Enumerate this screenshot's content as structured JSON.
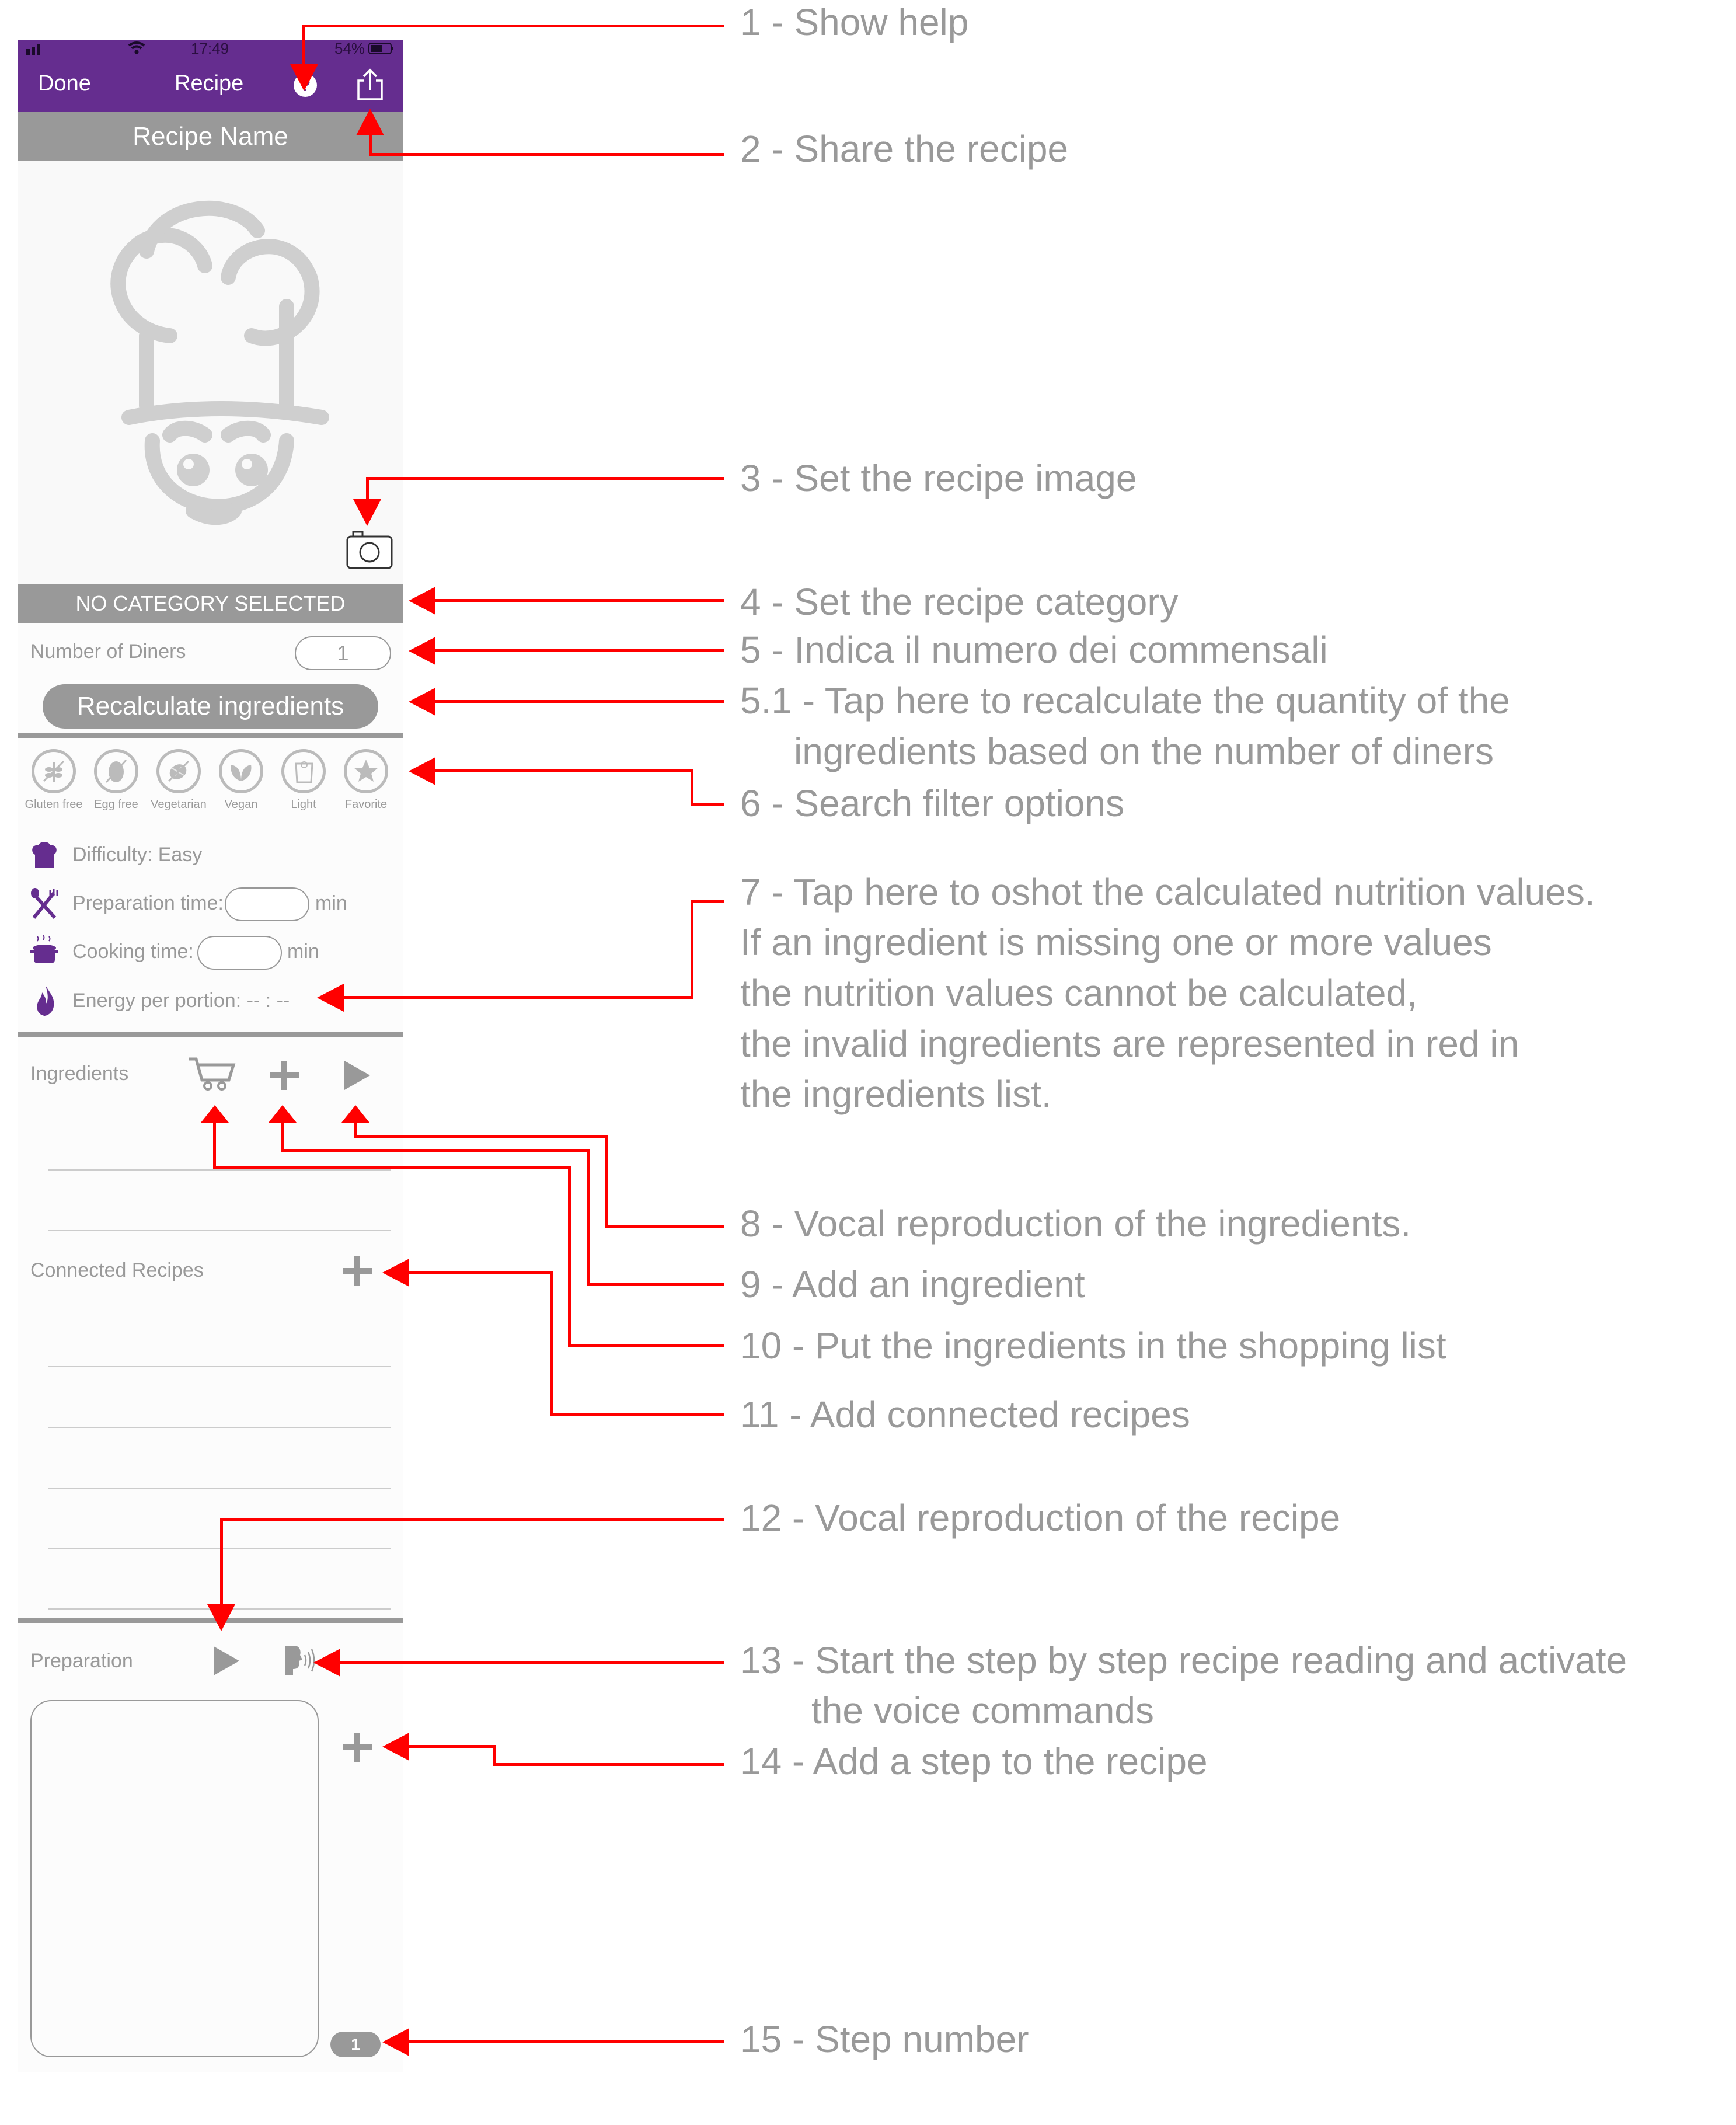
{
  "status_bar": {
    "time": "17:49",
    "battery": "54%"
  },
  "nav": {
    "done": "Done",
    "title": "Recipe",
    "help_icon": "help-circle-icon",
    "share_icon": "share-icon"
  },
  "recipe_name": "Recipe Name",
  "category": "NO CATEGORY SELECTED",
  "diners": {
    "label": "Number of Diners",
    "value": "1"
  },
  "recalc_button": "Recalculate ingredients",
  "filters": [
    {
      "label": "Gluten free",
      "icon": "gluten-free-icon"
    },
    {
      "label": "Egg free",
      "icon": "egg-free-icon"
    },
    {
      "label": "Vegetarian",
      "icon": "vegetarian-icon"
    },
    {
      "label": "Vegan",
      "icon": "vegan-icon"
    },
    {
      "label": "Light",
      "icon": "light-scale-icon"
    },
    {
      "label": "Favorite",
      "icon": "star-icon"
    }
  ],
  "details": {
    "difficulty_label": "Difficulty:",
    "difficulty_value": "Easy",
    "prep_label": "Preparation time:",
    "prep_value": "",
    "cook_label": "Cooking time:",
    "cook_value": "",
    "unit": "min",
    "energy_label": "Energy per portion:",
    "energy_value": "-- : --"
  },
  "ingredients": {
    "title": "Ingredients"
  },
  "connected": {
    "title": "Connected Recipes"
  },
  "preparation": {
    "title": "Preparation",
    "step_text": "",
    "step_number": "1"
  },
  "annotations": [
    "1 - Show help",
    "2 - Share the recipe",
    "3 - Set the recipe image",
    "4 - Set the recipe category",
    "5 - Indica il numero dei commensali",
    "5.1 - Tap here to recalculate the quantity of the",
    "ingredients based on the number of diners",
    "6 - Search filter options",
    "7 - Tap here to oshot the calculated nutrition values.",
    "If an ingredient is missing one or more values",
    "the nutrition values cannot be calculated,",
    "the invalid ingredients are represented in red in",
    "the ingredients list.",
    "8 - Vocal reproduction of the ingredients.",
    "9 - Add an ingredient",
    "10 - Put the ingredients in the shopping list",
    "11 - Add connected recipes",
    "12 - Vocal reproduction of the recipe",
    "13 - Start the step by step recipe reading and activate",
    "the voice commands",
    "14 - Add a step to the recipe",
    "15 - Step number"
  ],
  "colors": {
    "brand": "#652d8f",
    "gray": "#999999",
    "annotation_arrow": "#ff0000"
  }
}
